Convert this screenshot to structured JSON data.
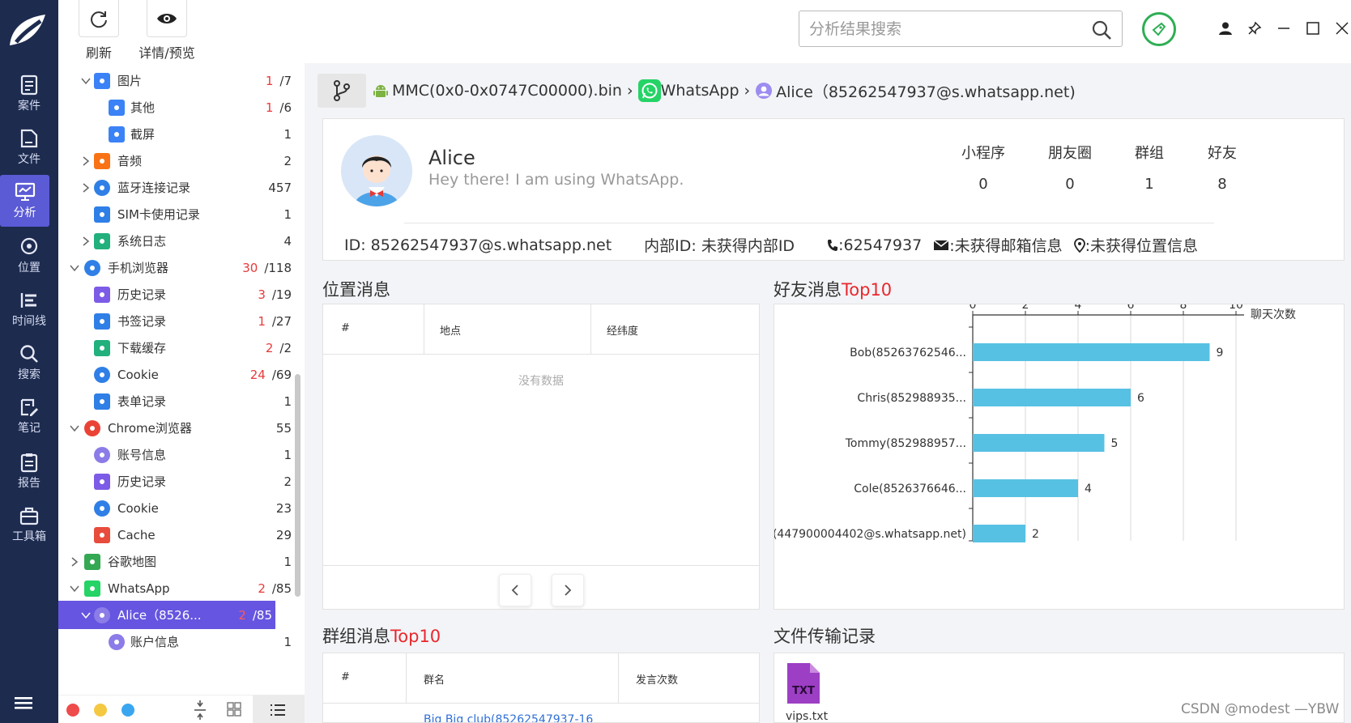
{
  "toolbar": {
    "refresh_label": "刷新",
    "preview_label": "详情/预览"
  },
  "nav": {
    "items": [
      {
        "label": "案件",
        "icon": "case-icon"
      },
      {
        "label": "文件",
        "icon": "file-icon"
      },
      {
        "label": "分析",
        "icon": "analysis-icon"
      },
      {
        "label": "位置",
        "icon": "location-icon"
      },
      {
        "label": "时间线",
        "icon": "timeline-icon"
      },
      {
        "label": "搜索",
        "icon": "search-icon"
      },
      {
        "label": "笔记",
        "icon": "note-icon"
      },
      {
        "label": "报告",
        "icon": "report-icon"
      },
      {
        "label": "工具箱",
        "icon": "toolbox-icon"
      }
    ]
  },
  "tree": {
    "rows": [
      {
        "label": "图片",
        "red": "1",
        "count": "/7",
        "icon": "image-icon",
        "color": "#3b82f6"
      },
      {
        "label": "其他",
        "red": "1",
        "count": "/6",
        "icon": "image-icon",
        "color": "#3b82f6"
      },
      {
        "label": "截屏",
        "red": "",
        "count": "1",
        "icon": "image-icon",
        "color": "#3b82f6"
      },
      {
        "label": "音频",
        "red": "",
        "count": "2",
        "icon": "audio-icon",
        "color": "#f97316"
      },
      {
        "label": "蓝牙连接记录",
        "red": "",
        "count": "457",
        "icon": "bluetooth-icon",
        "color": "#2f7fe6"
      },
      {
        "label": "SIM卡使用记录",
        "red": "",
        "count": "1",
        "icon": "sim-icon",
        "color": "#2f7fe6"
      },
      {
        "label": "系统日志",
        "red": "",
        "count": "4",
        "icon": "log-icon",
        "color": "#22b07d"
      },
      {
        "label": "手机浏览器",
        "red": "30",
        "count": "/118",
        "icon": "browser-globe-icon",
        "color": "#2f7fe6"
      },
      {
        "label": "历史记录",
        "red": "3",
        "count": "/19",
        "icon": "history-icon",
        "color": "#7c5ce6"
      },
      {
        "label": "书签记录",
        "red": "1",
        "count": "/27",
        "icon": "bookmark-icon",
        "color": "#2f7fe6"
      },
      {
        "label": "下载缓存",
        "red": "2",
        "count": "/2",
        "icon": "download-icon",
        "color": "#22b07d"
      },
      {
        "label": "Cookie",
        "red": "24",
        "count": "/69",
        "icon": "cookie-icon",
        "color": "#2f7fe6"
      },
      {
        "label": "表单记录",
        "red": "",
        "count": "1",
        "icon": "form-icon",
        "color": "#2f7fe6"
      },
      {
        "label": "Chrome浏览器",
        "red": "",
        "count": "55",
        "icon": "chrome-icon",
        "color": "#ea4335"
      },
      {
        "label": "账号信息",
        "red": "",
        "count": "1",
        "icon": "account-icon",
        "color": "#8b7ce8"
      },
      {
        "label": "历史记录",
        "red": "",
        "count": "2",
        "icon": "history-icon",
        "color": "#7c5ce6"
      },
      {
        "label": "Cookie",
        "red": "",
        "count": "23",
        "icon": "cookie-icon",
        "color": "#2f7fe6"
      },
      {
        "label": "Cache",
        "red": "",
        "count": "29",
        "icon": "cache-icon",
        "color": "#e74c3c"
      },
      {
        "label": "谷歌地图",
        "red": "",
        "count": "1",
        "icon": "map-pin-icon",
        "color": "#34a853"
      },
      {
        "label": "WhatsApp",
        "red": "2",
        "count": "/85",
        "icon": "whatsapp-icon",
        "color": "#25d366"
      },
      {
        "label": "Alice（8526...",
        "red": "2",
        "count": "/85",
        "icon": "account-icon",
        "color": "#8b7ce8"
      },
      {
        "label": "账户信息",
        "red": "",
        "count": "1",
        "icon": "account-icon",
        "color": "#8b7ce8"
      }
    ]
  },
  "search": {
    "placeholder": "分析结果搜索"
  },
  "breadcrumb": {
    "image": "MMC(0x0-0x0747C00000).bin",
    "app": "WhatsApp",
    "contact": "Alice（85262547937@s.whatsapp.net)",
    "sep": "›"
  },
  "profile": {
    "name": "Alice",
    "status": "Hey there! I am using WhatsApp.",
    "stats": [
      {
        "label": "小程序",
        "value": "0"
      },
      {
        "label": "朋友圈",
        "value": "0"
      },
      {
        "label": "群组",
        "value": "1"
      },
      {
        "label": "好友",
        "value": "8"
      }
    ],
    "id_text": "ID: 85262547937@s.whatsapp.net",
    "internal_id": "内部ID: 未获得内部ID",
    "phone": ":62547937",
    "email": ":未获得邮箱信息",
    "location": ":未获得位置信息"
  },
  "location_section": {
    "title": "位置消息",
    "columns": [
      "#",
      "地点",
      "经纬度"
    ],
    "empty_text": "没有数据"
  },
  "friends_section": {
    "title_a": "好友消息",
    "title_b": "Top10"
  },
  "groups_section": {
    "title_a": "群组消息",
    "title_b": "Top10",
    "columns": [
      "#",
      "群名",
      "发言次数"
    ],
    "first_row": "Big Big club(85262547937-16"
  },
  "files_section": {
    "title": "文件传输记录",
    "file_name": "vips.txt",
    "file_badge": "TXT"
  },
  "watermark": "CSDN @modest —YBW",
  "chart_data": {
    "type": "bar",
    "orientation": "horizontal",
    "categories": [
      "Bob(85263762546...",
      "Chris(852988935...",
      "Tommy(852988957...",
      "Cole(8526376646...",
      "(447900004402@s.whatsapp.net)"
    ],
    "values": [
      9,
      6,
      5,
      4,
      2
    ],
    "xlabel": "聊天次数",
    "xlim": [
      0,
      10
    ],
    "xticks": [
      "0",
      "2",
      "4",
      "6",
      "8",
      "10"
    ],
    "grid": true,
    "bar_color": "#57c1e3"
  }
}
